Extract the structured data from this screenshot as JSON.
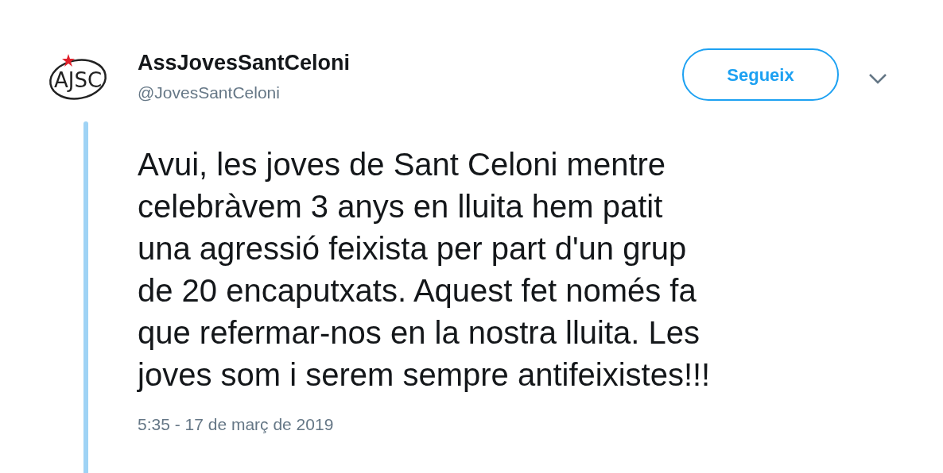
{
  "author": {
    "avatar_text": "AJSC",
    "name": "AssJovesSantCeloni",
    "handle": "@JovesSantCeloni"
  },
  "follow_button": {
    "label": "Segueix"
  },
  "tweet": {
    "lines": [
      "Avui, les joves de Sant Celoni mentre",
      "celebràvem 3 anys en lluita hem patit",
      "una agressió feixista per part d'un grup",
      "de 20 encaputxats. Aquest fet només fa",
      "que refermar-nos en la nostra lluita. Les",
      "joves som i serem sempre antifeixistes!!!"
    ],
    "timestamp": "5:35 - 17 de març de 2019"
  }
}
